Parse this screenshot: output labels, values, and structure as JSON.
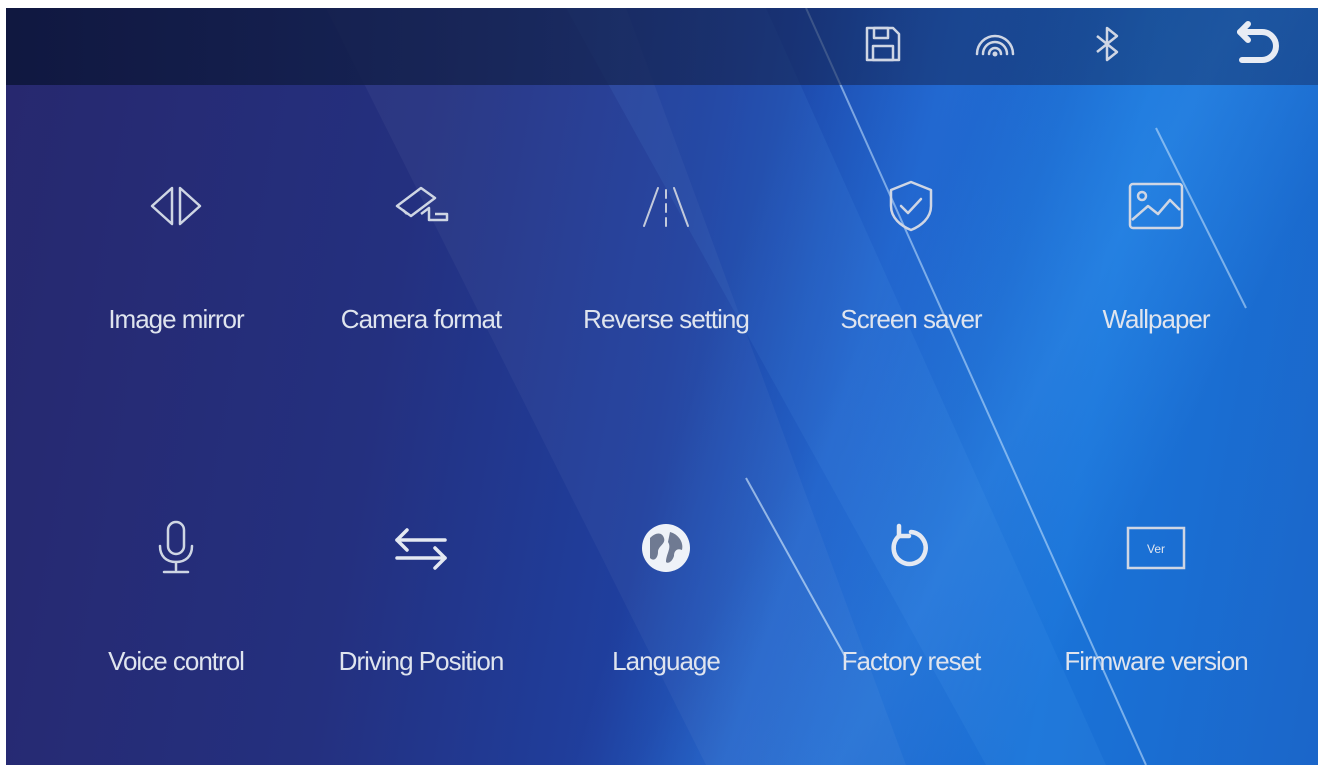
{
  "topbar": {
    "icons": [
      "save-icon",
      "hotspot-icon",
      "bluetooth-icon",
      "back-icon"
    ]
  },
  "menu": {
    "items": [
      {
        "label": "Image mirror",
        "icon": "mirror-icon"
      },
      {
        "label": "Camera format",
        "icon": "camera-icon"
      },
      {
        "label": "Reverse setting",
        "icon": "road-lines-icon"
      },
      {
        "label": "Screen saver",
        "icon": "shield-check-icon"
      },
      {
        "label": "Wallpaper",
        "icon": "picture-icon"
      },
      {
        "label": "Voice control",
        "icon": "microphone-icon"
      },
      {
        "label": "Driving Position",
        "icon": "swap-arrows-icon"
      },
      {
        "label": "Language",
        "icon": "globe-icon"
      },
      {
        "label": "Factory reset",
        "icon": "reset-icon"
      },
      {
        "label": "Firmware version",
        "icon": "version-icon"
      },
      {
        "version_badge": "Ver"
      }
    ]
  },
  "colors": {
    "label": "#dfe4ee",
    "icon": "#cfd6e4"
  }
}
